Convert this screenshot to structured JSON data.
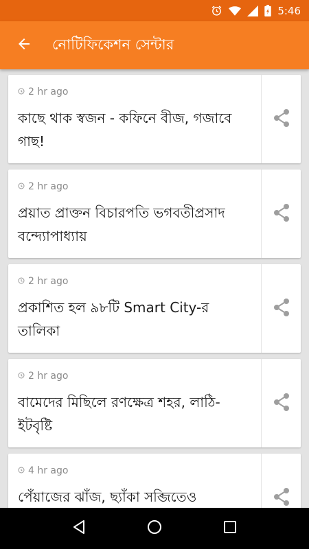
{
  "status_bar": {
    "time": "5:46",
    "icons": [
      "alarm-icon",
      "wifi-icon",
      "signal-icon",
      "battery-icon"
    ]
  },
  "app_bar": {
    "title": "নোটিফিকেশন সেন্টার",
    "back_icon": "arrow-back-icon"
  },
  "notifications": [
    {
      "time": "2 hr ago",
      "headline": "কাছে থাক স্বজন - কফিনে বীজ, গজাবে গাছ!"
    },
    {
      "time": "2 hr ago",
      "headline": "প্রয়াত প্রাক্তন বিচারপতি ভগবতীপ্রসাদ বন্দ্যোপাধ্যায়"
    },
    {
      "time": "2 hr ago",
      "headline": "প্রকাশিত হল ৯৮টি Smart City-র তালিকা"
    },
    {
      "time": "2 hr ago",
      "headline": "বামেদের মিছিলে রণক্ষেত্র শহর, লাঠি-ইটবৃষ্টি"
    },
    {
      "time": "4 hr ago",
      "headline": "পেঁয়াজের ঝাঁজ, ছ্যাঁকা সব্জিতেও"
    }
  ],
  "colors": {
    "app_bar": "#f67e22",
    "status_bar": "#e6650f",
    "background": "#e3e3e3"
  },
  "nav_bar": {
    "icons": [
      "back-triangle-icon",
      "home-circle-icon",
      "recents-square-icon"
    ]
  }
}
